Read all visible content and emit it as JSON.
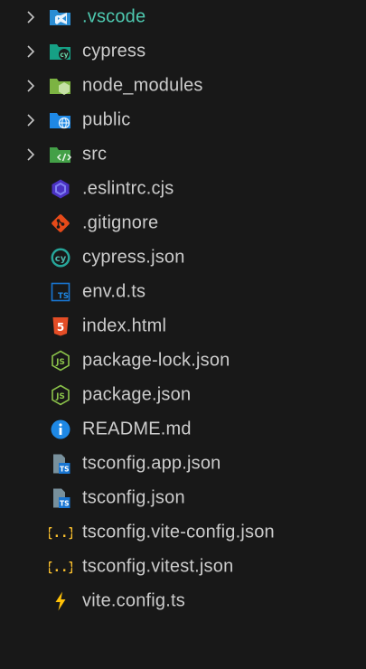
{
  "explorer": {
    "items": [
      {
        "label": ".vscode",
        "icon": "vscode-folder-icon",
        "type": "folder"
      },
      {
        "label": "cypress",
        "icon": "cypress-folder-icon",
        "type": "folder"
      },
      {
        "label": "node_modules",
        "icon": "node-folder-icon",
        "type": "folder"
      },
      {
        "label": "public",
        "icon": "public-folder-icon",
        "type": "folder"
      },
      {
        "label": "src",
        "icon": "src-folder-icon",
        "type": "folder"
      },
      {
        "label": ".eslintrc.cjs",
        "icon": "eslint-icon",
        "type": "file"
      },
      {
        "label": ".gitignore",
        "icon": "git-icon",
        "type": "file"
      },
      {
        "label": "cypress.json",
        "icon": "cypress-icon",
        "type": "file"
      },
      {
        "label": "env.d.ts",
        "icon": "typescript-def-icon",
        "type": "file"
      },
      {
        "label": "index.html",
        "icon": "html5-icon",
        "type": "file"
      },
      {
        "label": "package-lock.json",
        "icon": "nodejs-icon",
        "type": "file"
      },
      {
        "label": "package.json",
        "icon": "nodejs-icon",
        "type": "file"
      },
      {
        "label": "README.md",
        "icon": "info-icon",
        "type": "file"
      },
      {
        "label": "tsconfig.app.json",
        "icon": "tsconfig-icon",
        "type": "file"
      },
      {
        "label": "tsconfig.json",
        "icon": "tsconfig-icon",
        "type": "file"
      },
      {
        "label": "tsconfig.vite-config.json",
        "icon": "json-braces-icon",
        "type": "file"
      },
      {
        "label": "tsconfig.vitest.json",
        "icon": "json-braces-icon",
        "type": "file"
      },
      {
        "label": "vite.config.ts",
        "icon": "vite-icon",
        "type": "file"
      }
    ]
  },
  "colors": {
    "background": "#181818",
    "text": "#cccccc",
    "vscode_label": "#4ec9b0"
  }
}
